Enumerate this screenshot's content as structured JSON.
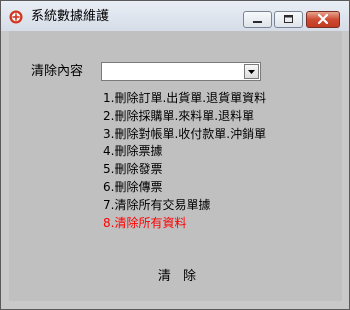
{
  "window": {
    "title": "系統數據維護",
    "icon": "app-icon",
    "controls": [
      "minimize-icon",
      "maximize-icon",
      "close-icon"
    ]
  },
  "form": {
    "field_label": "清除內容",
    "combo_value": "",
    "options": [
      "1.刪除訂單.出貨單.退貨單資料",
      "2.刪除採購單.來料單.退料單",
      "3.刪除對帳單.收付款單.沖銷單",
      "4.刪除票據",
      "5.刪除發票",
      "6.刪除傳票",
      "7.清除所有交易單據",
      "8.清除所有資料"
    ],
    "clear_button": "清 除"
  },
  "colors": {
    "window_bg": "#c0c0c0",
    "danger_text": "#ff0000",
    "close_button": "#c8422b"
  }
}
